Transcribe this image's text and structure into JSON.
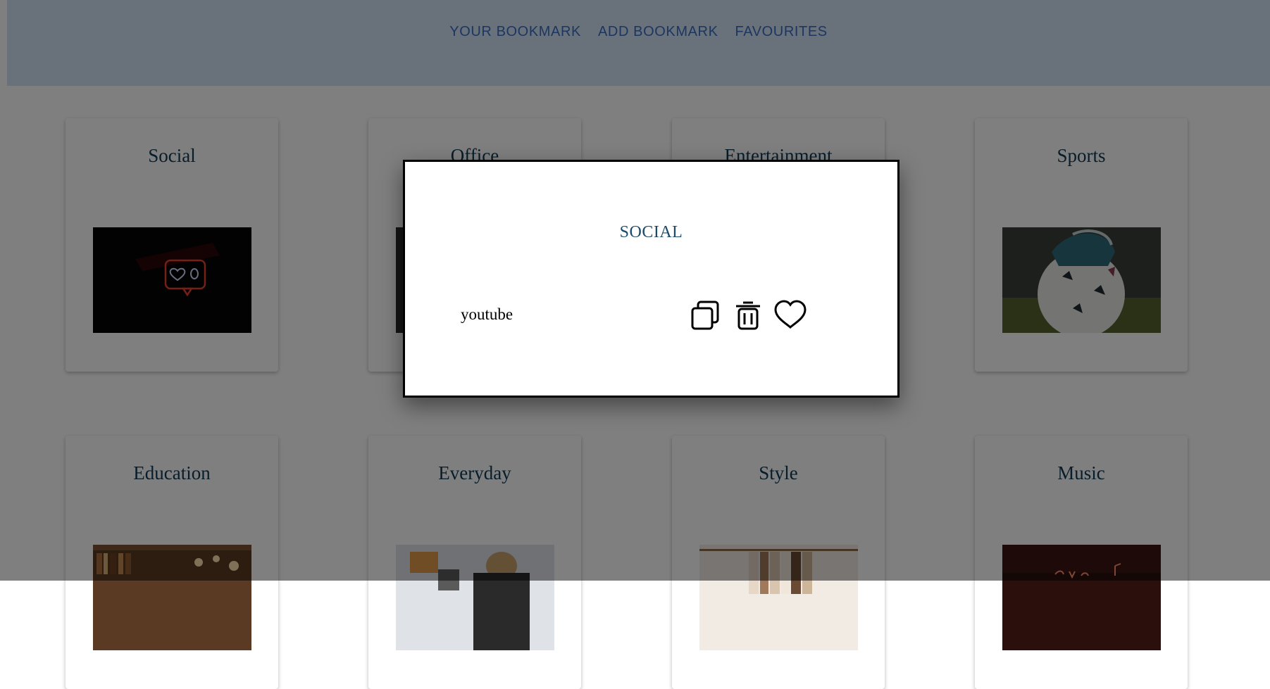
{
  "nav": {
    "links": [
      "YOUR BOOKMARK",
      "ADD BOOKMARK",
      "FAVOURITES"
    ]
  },
  "categories": [
    {
      "title": "Social",
      "image": "neon-heart-notification-photo"
    },
    {
      "title": "Office",
      "image": "office-photo"
    },
    {
      "title": "Entertainment",
      "image": "entertainment-photo"
    },
    {
      "title": "Sports",
      "image": "soccer-ball-photo"
    },
    {
      "title": "Education",
      "image": "library-bookshelf-photo"
    },
    {
      "title": "Everyday",
      "image": "woman-everyday-photo"
    },
    {
      "title": "Style",
      "image": "clothing-rack-photo"
    },
    {
      "title": "Music",
      "image": "neon-music-sign-photo"
    }
  ],
  "modal": {
    "title": "SOCIAL",
    "bookmarks": [
      {
        "name": "youtube",
        "actions": [
          "copy-icon",
          "trash-icon",
          "heart-icon"
        ]
      }
    ]
  },
  "colors": {
    "nav_bg": "#d3e4f7",
    "nav_link": "#3a6cc1",
    "card_title": "#0f3a56",
    "modal_title": "#1b4a6a",
    "overlay": "rgba(0,0,0,0.5)"
  }
}
